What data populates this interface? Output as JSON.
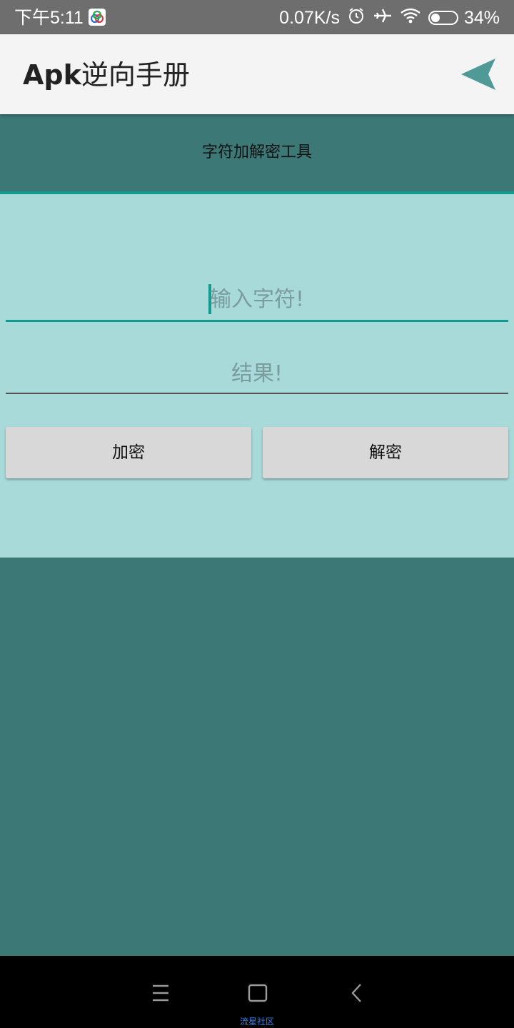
{
  "status_bar": {
    "time": "下午5:11",
    "net_speed": "0.07K/s",
    "battery_pct": "34%",
    "battery_level": 0.34,
    "icons": [
      "gallery-icon",
      "alarm-icon",
      "airplane-mode-icon",
      "wifi-icon",
      "battery-icon"
    ]
  },
  "app_bar": {
    "title_latin": "Apk",
    "title_cn": "逆向手册",
    "action_icon": "send-icon",
    "accent_color": "#4f9a97"
  },
  "tool": {
    "title": "字符加解密工具",
    "input_placeholder": "输入字符!",
    "result_placeholder": "结果!",
    "encrypt_label": "加密",
    "decrypt_label": "解密"
  },
  "colors": {
    "background": "#3b7876",
    "panel": "#a8dada",
    "accent": "#139b8f",
    "button": "#d8d8d8"
  },
  "nav_bar": {
    "icons": [
      "menu-icon",
      "home-icon",
      "back-icon"
    ],
    "watermark": "流星社区"
  }
}
